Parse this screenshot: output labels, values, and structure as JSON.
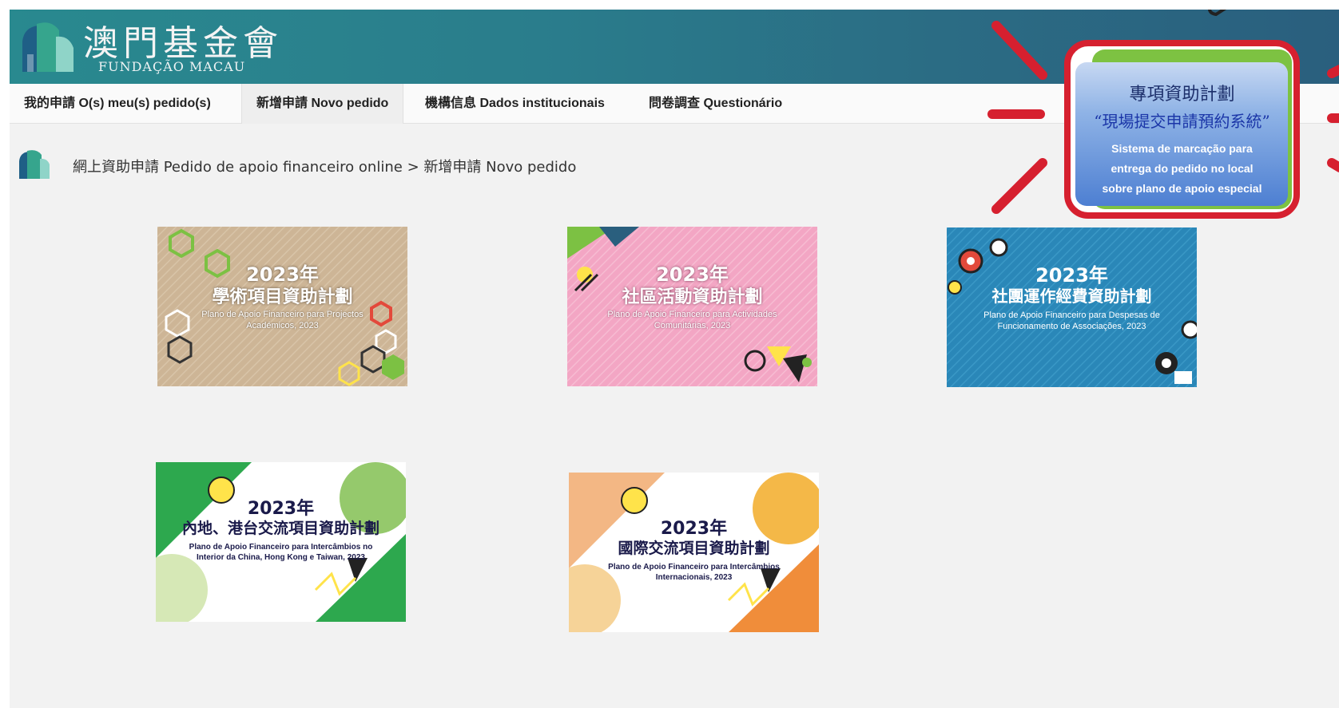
{
  "header": {
    "brand_cn": "澳門基金會",
    "brand_pt": "FUNDAÇÃO MACAU"
  },
  "nav": {
    "tabs": [
      {
        "label": "我的申請 O(s) meu(s) pedido(s)"
      },
      {
        "label": "新增申請 Novo pedido",
        "active": true
      },
      {
        "label": "機構信息 Dados institucionais"
      },
      {
        "label": "問卷調查 Questionário"
      }
    ]
  },
  "breadcrumb": {
    "root": "網上資助申請 Pedido de apoio financeiro online",
    "separator": ">",
    "current": "新增申請 Novo pedido"
  },
  "cards": [
    {
      "year": "2023年",
      "title": "學術項目資助計劃",
      "subtitle": "Plano de Apoio Financeiro para Projectos Académicos, 2023",
      "theme_color": "#cdb596"
    },
    {
      "year": "2023年",
      "title": "社區活動資助計劃",
      "subtitle": "Plano de Apoio Financeiro para Actividades Comunitárias, 2023",
      "theme_color": "#f3a6c4"
    },
    {
      "year": "2023年",
      "title": "社團運作經費資助計劃",
      "subtitle": "Plano de Apoio Financeiro para Despesas de Funcionamento de Associações, 2023",
      "theme_color": "#2a87b8"
    },
    {
      "year": "2023年",
      "title": "內地、港台交流項目資助計劃",
      "subtitle": "Plano de Apoio Financeiro para Intercâmbios no Interior da China, Hong Kong e Taiwan, 2023",
      "theme_color": "#2da84e"
    },
    {
      "year": "2023年",
      "title": "國際交流項目資助計劃",
      "subtitle": "Plano de Apoio Financeiro para Intercâmbios Internacionais, 2023",
      "theme_color": "#f1a64a"
    }
  ],
  "promo": {
    "line1": "專項資助計劃",
    "line2": "“現場提交申請預約系統”",
    "sub1": "Sistema de marcação para",
    "sub2": "entrega do pedido no local",
    "sub3": "sobre plano de apoio especial"
  },
  "colors": {
    "header_start": "#29898f",
    "header_end": "#2a5f7e",
    "accent_red": "#d6202f",
    "promo_green": "#7dc242",
    "promo_blue": "#4d7fd2"
  }
}
